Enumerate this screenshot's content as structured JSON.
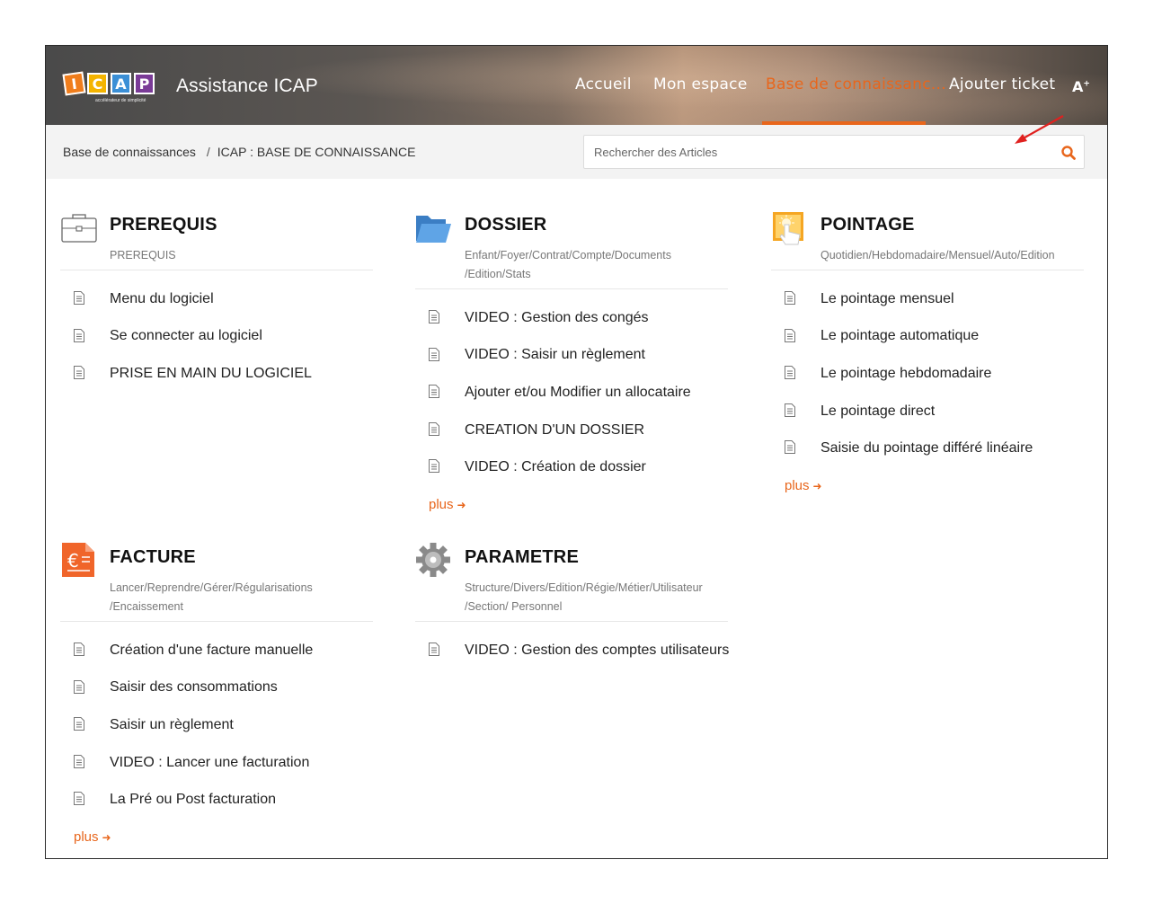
{
  "header": {
    "logo_letters": [
      "I",
      "C",
      "A",
      "P"
    ],
    "logo_colors": [
      "#f07d1b",
      "#f4b400",
      "#3b8fd6",
      "#7a3b97"
    ],
    "logo_tagline": "accélérateur de simplicité",
    "site_title": "Assistance ICAP",
    "nav": [
      {
        "label": "Accueil",
        "active": false
      },
      {
        "label": "Mon espace",
        "active": false
      },
      {
        "label": "Base de connaissanc...",
        "active": true
      },
      {
        "label": "Ajouter ticket",
        "active": false
      }
    ],
    "font_toggle": "A",
    "font_toggle_sup": "+",
    "accent_color": "#e8661c"
  },
  "breadcrumb": {
    "root": "Base de connaissances",
    "separator": "/",
    "current": "ICAP : BASE DE CONNAISSANCE"
  },
  "search": {
    "placeholder": "Rechercher des Articles",
    "value": "",
    "icon": "search-icon"
  },
  "categories": [
    {
      "title": "PREREQUIS",
      "icon": "briefcase-icon",
      "subtitle_lines": [
        "PREREQUIS"
      ],
      "articles": [
        "Menu du logiciel",
        "Se connecter au logiciel",
        "PRISE EN MAIN DU LOGICIEL"
      ],
      "more": null
    },
    {
      "title": "DOSSIER",
      "icon": "folder-icon",
      "subtitle_lines": [
        "Enfant/Foyer/Contrat/Compte/Documents",
        "/Edition/Stats"
      ],
      "articles": [
        "VIDEO : Gestion des congés",
        "VIDEO : Saisir un règlement",
        "Ajouter et/ou Modifier un allocataire",
        "CREATION D'UN DOSSIER",
        "VIDEO : Création de dossier"
      ],
      "more": "plus"
    },
    {
      "title": "POINTAGE",
      "icon": "pointage-touch-icon",
      "subtitle_lines": [
        "Quotidien/Hebdomadaire/Mensuel/Auto/Edition"
      ],
      "articles": [
        "Le pointage mensuel",
        "Le pointage automatique",
        "Le pointage hebdomadaire",
        "Le pointage direct",
        "Saisie du pointage différé linéaire"
      ],
      "more": "plus"
    },
    {
      "title": "FACTURE",
      "icon": "euro-invoice-icon",
      "subtitle_lines": [
        "Lancer/Reprendre/Gérer/Régularisations",
        "/Encaissement"
      ],
      "articles": [
        "Création d'une facture manuelle",
        "Saisir des consommations",
        "Saisir un règlement",
        "VIDEO : Lancer une facturation",
        "La Pré ou Post facturation"
      ],
      "more": "plus"
    },
    {
      "title": "PARAMETRE",
      "icon": "gear-icon",
      "subtitle_lines": [
        "Structure/Divers/Edition/Régie/Métier/Utilisateur",
        "/Section/ Personnel"
      ],
      "articles": [
        "VIDEO : Gestion des comptes utilisateurs"
      ],
      "more": null
    }
  ]
}
